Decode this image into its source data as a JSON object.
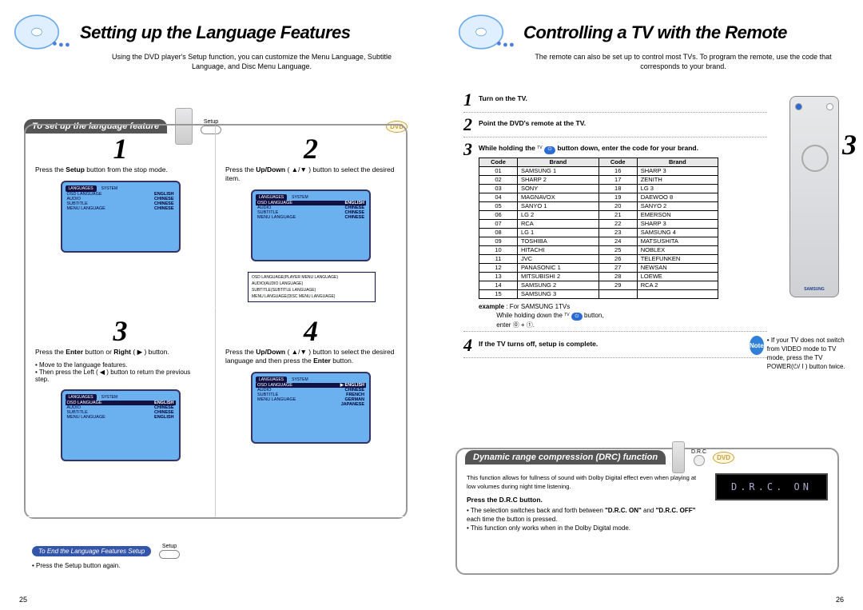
{
  "left": {
    "title": "Setting up the Language Features",
    "subtitle": "Using the DVD player's Setup function, you can customize the Menu Language, Subtitle Language, and Disc Menu Language.",
    "section_bar": "To set up the language feature",
    "setup_label": "Setup",
    "steps": {
      "s1": {
        "num": "1",
        "text_a": "Press the ",
        "b1": "Setup",
        "text_b": " button from the stop mode."
      },
      "s2": {
        "num": "2",
        "text_a": "Press the ",
        "b1": "Up/Down",
        "text_b": " ( ▲/▼ )  button  to select the desired item."
      },
      "s3": {
        "num": "3",
        "text_a": "Press the ",
        "b1": "Enter",
        "text_b": " button or ",
        "b2": "Right",
        "text_c": " ( ▶ ) button."
      },
      "s4": {
        "num": "4",
        "text_a": "Press the ",
        "b1": "Up/Down",
        "text_b": " ( ▲/▼ ) button to select the desired language and then press the ",
        "b2": "Enter",
        "text_c": " button."
      }
    },
    "tv_tabs": {
      "a": "LANGUAGES",
      "b": "SYSTEM"
    },
    "tv_items": {
      "r1a": "OSD LANGUAGE",
      "r1b": "ENGLISH",
      "r2a": "AUDIO",
      "r2b": "CHINESE",
      "r3a": "SUBTITLE",
      "r3b": "CHINESE",
      "r4a": "MENU LANGUAGE",
      "r4b": "CHINESE"
    },
    "tv3_items": {
      "r1a": "OSD LANGUAGE",
      "r1b": "ENGLISH",
      "r2a": "AUDIO",
      "r2b": "CHINESE",
      "r3a": "SUBTITLE",
      "r3b": "CHINESE",
      "r4a": "MENU LANGUAGE",
      "r4b": "ENGLISH"
    },
    "tv2_overlay": {
      "o1a": "OSD LANGUAGE",
      "o1b": "(PLAYER MENU LANGUAGE)",
      "o2a": "AUDIO",
      "o2b": "(AUDIO LANGUAGE)",
      "o3a": "SUBTITLE",
      "o3b": "(SUBTITLE LANGUAGE)",
      "o4a": "MENU LANGUAGE",
      "o4b": "(DISC MENU LANGUAGE)"
    },
    "tv4_items": {
      "r1a": "OSD LANGUAGE",
      "r1b": "▶ ENGLISH",
      "r2a": "AUDIO",
      "r2b": "CHINESE",
      "r3a": "SUBTITLE",
      "r3b": "FRENCH",
      "r4a": "MENU LANGUAGE",
      "r4b": "GERMAN",
      "r5b": "JAPANESE"
    },
    "bullets": {
      "b1": "Move to the language features.",
      "b2": "Then press the Left ( ◀ ) button to return the previous step."
    },
    "end_bar": "To End the Language Features Setup",
    "end_setup_label": "Setup",
    "end_text": "Press the Setup button again.",
    "page_num": "25"
  },
  "right": {
    "title": "Controlling a TV with the Remote",
    "subtitle": "The remote can also be set up to control most TVs. To program the remote, use the code that corresponds to your brand.",
    "side_num": "3",
    "steps": {
      "s1": {
        "num": "1",
        "text": "Turn on the TV."
      },
      "s2": {
        "num": "2",
        "text": "Point the DVD's remote at the TV."
      },
      "s3": {
        "num": "3",
        "text_a": "While holding the ",
        "text_b": " button down, enter the code for your brand."
      },
      "s4": {
        "num": "4",
        "text": "If the TV turns off, setup is complete."
      }
    },
    "tv_label": "TV",
    "table_headers": {
      "c1": "Code",
      "c2": "Brand",
      "c3": "Code",
      "c4": "Brand"
    },
    "codes": [
      [
        "01",
        "SAMSUNG 1",
        "16",
        "SHARP 3"
      ],
      [
        "02",
        "SHARP 2",
        "17",
        "ZENITH"
      ],
      [
        "03",
        "SONY",
        "18",
        "LG 3"
      ],
      [
        "04",
        "MAGNAVOX",
        "19",
        "DAEWOO 8"
      ],
      [
        "05",
        "SANYO 1",
        "20",
        "SANYO 2"
      ],
      [
        "06",
        "LG 2",
        "21",
        "EMERSON"
      ],
      [
        "07",
        "RCA",
        "22",
        "SHARP 3"
      ],
      [
        "08",
        "LG 1",
        "23",
        "SAMSUNG 4"
      ],
      [
        "09",
        "TOSHIBA",
        "24",
        "MATSUSHITA"
      ],
      [
        "10",
        "HITACHI",
        "25",
        "NOBLEX"
      ],
      [
        "11",
        "JVC",
        "26",
        "TELEFUNKEN"
      ],
      [
        "12",
        "PANASONIC 1",
        "27",
        "NEWSAN"
      ],
      [
        "13",
        "MITSUBISHI 2",
        "28",
        "LOEWE"
      ],
      [
        "14",
        "SAMSUNG 2",
        "29",
        "RCA 2"
      ],
      [
        "15",
        "SAMSUNG 3",
        "",
        ""
      ]
    ],
    "example_label": "example",
    "example_text_a": " : For SAMSUNG 1TVs",
    "example_text_b": "While holding down the ",
    "example_text_c": " button,",
    "example_text_d": "enter ⓪ + ①.",
    "note_label": "Note",
    "note_text": "If your TV does not switch from VIDEO mode to TV mode, press the TV POWER(⏻/ I ) button twice.",
    "drc": {
      "bar": "Dynamic range compression (DRC) function",
      "drc_label": "D.R.C",
      "desc": "This function allows for fullness of sound with Dolby Digital effect even when playing at low volumes during night time listening.",
      "press_b": "Press the D.R.C button.",
      "bul1_a": "The selection switches back and forth between ",
      "bul1_b": "\"D.R.C. ON\"",
      "bul1_c": " and ",
      "bul1_d": "\"D.R.C. OFF\"",
      "bul1_e": " each time the button is pressed.",
      "bul2": "This function only works when in the Dolby Digital mode.",
      "lcd": "D.R.C. ON"
    },
    "page_num": "26"
  }
}
